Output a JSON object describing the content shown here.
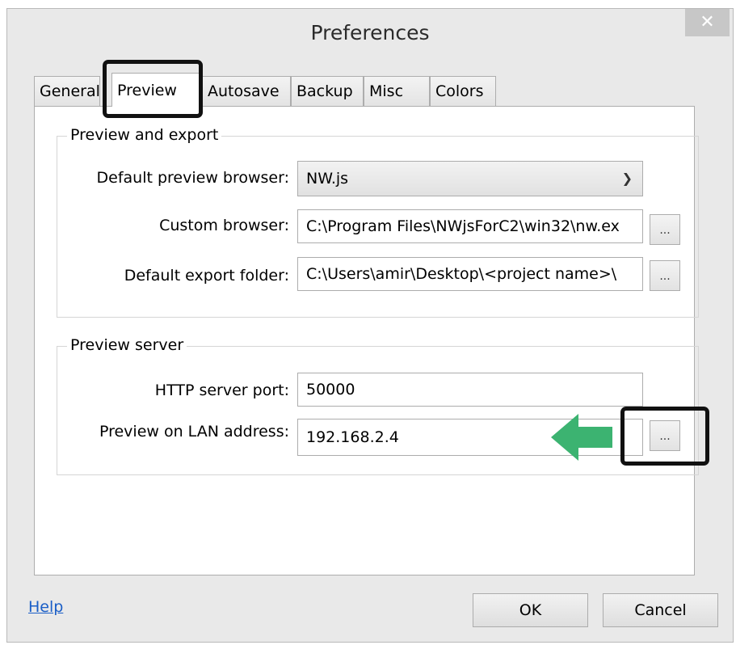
{
  "window": {
    "title": "Preferences",
    "close_glyph": "✕"
  },
  "tabs": [
    {
      "label": "General"
    },
    {
      "label": "Preview"
    },
    {
      "label": "Autosave"
    },
    {
      "label": "Backup"
    },
    {
      "label": "Misc"
    },
    {
      "label": "Colors"
    }
  ],
  "preview_export": {
    "legend": "Preview and export",
    "default_browser_label": "Default preview browser:",
    "default_browser_value": "NW.js",
    "custom_browser_label": "Custom browser:",
    "custom_browser_value": "C:\\Program Files\\NWjsForC2\\win32\\nw.ex",
    "export_folder_label": "Default export folder:",
    "export_folder_value": "C:\\Users\\amir\\Desktop\\<project name>\\",
    "browse_label": "..."
  },
  "preview_server": {
    "legend": "Preview server",
    "port_label": "HTTP server port:",
    "port_value": "50000",
    "lan_label": "Preview on LAN address:",
    "lan_value": "192.168.2.4",
    "browse_label": "..."
  },
  "footer": {
    "help": "Help",
    "ok": "OK",
    "cancel": "Cancel"
  },
  "colors": {
    "highlight_border": "#111111",
    "arrow": "#3cb371",
    "link": "#1a5ec7"
  }
}
